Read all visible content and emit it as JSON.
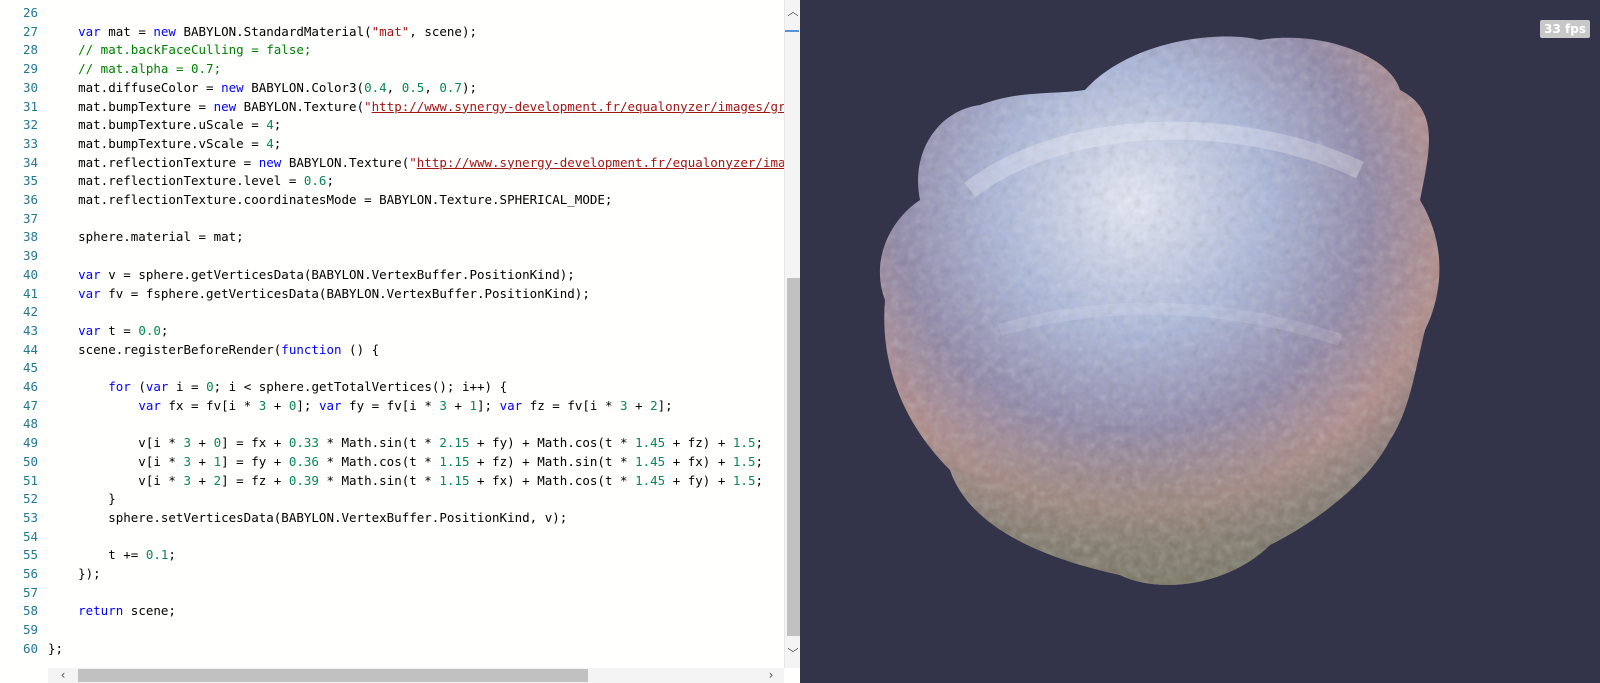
{
  "editor": {
    "lines": [
      {
        "n": "26",
        "tokens": []
      },
      {
        "n": "27",
        "tokens": [
          {
            "t": "    "
          },
          {
            "t": "var",
            "c": "kw"
          },
          {
            "t": " mat = "
          },
          {
            "t": "new",
            "c": "kw"
          },
          {
            "t": " BABYLON.StandardMaterial("
          },
          {
            "t": "\"mat\"",
            "c": "st"
          },
          {
            "t": ", scene);"
          }
        ]
      },
      {
        "n": "28",
        "tokens": [
          {
            "t": "    "
          },
          {
            "t": "// mat.backFaceCulling = false;",
            "c": "cm"
          }
        ]
      },
      {
        "n": "29",
        "tokens": [
          {
            "t": "    "
          },
          {
            "t": "// mat.alpha = 0.7;",
            "c": "cm"
          }
        ]
      },
      {
        "n": "30",
        "tokens": [
          {
            "t": "    mat.diffuseColor = "
          },
          {
            "t": "new",
            "c": "kw"
          },
          {
            "t": " BABYLON.Color3("
          },
          {
            "t": "0.4",
            "c": "nm"
          },
          {
            "t": ", "
          },
          {
            "t": "0.5",
            "c": "nm"
          },
          {
            "t": ", "
          },
          {
            "t": "0.7",
            "c": "nm"
          },
          {
            "t": ");"
          }
        ]
      },
      {
        "n": "31",
        "tokens": [
          {
            "t": "    mat.bumpTexture = "
          },
          {
            "t": "new",
            "c": "kw"
          },
          {
            "t": " BABYLON.Texture("
          },
          {
            "t": "\"",
            "c": "st"
          },
          {
            "t": "http://www.synergy-development.fr/equalonyzer/images/gr",
            "c": "url"
          }
        ]
      },
      {
        "n": "32",
        "tokens": [
          {
            "t": "    mat.bumpTexture.uScale = "
          },
          {
            "t": "4",
            "c": "nm"
          },
          {
            "t": ";"
          }
        ]
      },
      {
        "n": "33",
        "tokens": [
          {
            "t": "    mat.bumpTexture.vScale = "
          },
          {
            "t": "4",
            "c": "nm"
          },
          {
            "t": ";"
          }
        ]
      },
      {
        "n": "34",
        "tokens": [
          {
            "t": "    mat.reflectionTexture = "
          },
          {
            "t": "new",
            "c": "kw"
          },
          {
            "t": " BABYLON.Texture("
          },
          {
            "t": "\"",
            "c": "st"
          },
          {
            "t": "http://www.synergy-development.fr/equalonyzer/ima",
            "c": "url"
          }
        ]
      },
      {
        "n": "35",
        "tokens": [
          {
            "t": "    mat.reflectionTexture.level = "
          },
          {
            "t": "0.6",
            "c": "nm"
          },
          {
            "t": ";"
          }
        ]
      },
      {
        "n": "36",
        "tokens": [
          {
            "t": "    mat.reflectionTexture.coordinatesMode = BABYLON.Texture.SPHERICAL_MODE;"
          }
        ]
      },
      {
        "n": "37",
        "tokens": []
      },
      {
        "n": "38",
        "tokens": [
          {
            "t": "    sphere.material = mat;"
          }
        ]
      },
      {
        "n": "39",
        "tokens": []
      },
      {
        "n": "40",
        "tokens": [
          {
            "t": "    "
          },
          {
            "t": "var",
            "c": "kw"
          },
          {
            "t": " v = sphere.getVerticesData(BABYLON.VertexBuffer.PositionKind);"
          }
        ]
      },
      {
        "n": "41",
        "tokens": [
          {
            "t": "    "
          },
          {
            "t": "var",
            "c": "kw"
          },
          {
            "t": " fv = fsphere.getVerticesData(BABYLON.VertexBuffer.PositionKind);"
          }
        ]
      },
      {
        "n": "42",
        "tokens": []
      },
      {
        "n": "43",
        "tokens": [
          {
            "t": "    "
          },
          {
            "t": "var",
            "c": "kw"
          },
          {
            "t": " t = "
          },
          {
            "t": "0.0",
            "c": "nm"
          },
          {
            "t": ";"
          }
        ]
      },
      {
        "n": "44",
        "tokens": [
          {
            "t": "    scene.registerBeforeRender("
          },
          {
            "t": "function",
            "c": "kw"
          },
          {
            "t": " () {"
          }
        ]
      },
      {
        "n": "45",
        "tokens": []
      },
      {
        "n": "46",
        "tokens": [
          {
            "t": "        "
          },
          {
            "t": "for",
            "c": "kw"
          },
          {
            "t": " ("
          },
          {
            "t": "var",
            "c": "kw"
          },
          {
            "t": " i = "
          },
          {
            "t": "0",
            "c": "nm"
          },
          {
            "t": "; i < sphere.getTotalVertices(); i++) {"
          }
        ]
      },
      {
        "n": "47",
        "tokens": [
          {
            "t": "            "
          },
          {
            "t": "var",
            "c": "kw"
          },
          {
            "t": " fx = fv[i * "
          },
          {
            "t": "3",
            "c": "nm"
          },
          {
            "t": " + "
          },
          {
            "t": "0",
            "c": "nm"
          },
          {
            "t": "]; "
          },
          {
            "t": "var",
            "c": "kw"
          },
          {
            "t": " fy = fv[i * "
          },
          {
            "t": "3",
            "c": "nm"
          },
          {
            "t": " + "
          },
          {
            "t": "1",
            "c": "nm"
          },
          {
            "t": "]; "
          },
          {
            "t": "var",
            "c": "kw"
          },
          {
            "t": " fz = fv[i * "
          },
          {
            "t": "3",
            "c": "nm"
          },
          {
            "t": " + "
          },
          {
            "t": "2",
            "c": "nm"
          },
          {
            "t": "];"
          }
        ]
      },
      {
        "n": "48",
        "tokens": []
      },
      {
        "n": "49",
        "tokens": [
          {
            "t": "            v[i * "
          },
          {
            "t": "3",
            "c": "nm"
          },
          {
            "t": " + "
          },
          {
            "t": "0",
            "c": "nm"
          },
          {
            "t": "] = fx + "
          },
          {
            "t": "0.33",
            "c": "nm"
          },
          {
            "t": " * Math.sin(t * "
          },
          {
            "t": "2.15",
            "c": "nm"
          },
          {
            "t": " + fy) + Math.cos(t * "
          },
          {
            "t": "1.45",
            "c": "nm"
          },
          {
            "t": " + fz) + "
          },
          {
            "t": "1.5",
            "c": "nm"
          },
          {
            "t": ";"
          }
        ]
      },
      {
        "n": "50",
        "tokens": [
          {
            "t": "            v[i * "
          },
          {
            "t": "3",
            "c": "nm"
          },
          {
            "t": " + "
          },
          {
            "t": "1",
            "c": "nm"
          },
          {
            "t": "] = fy + "
          },
          {
            "t": "0.36",
            "c": "nm"
          },
          {
            "t": " * Math.cos(t * "
          },
          {
            "t": "1.15",
            "c": "nm"
          },
          {
            "t": " + fz) + Math.sin(t * "
          },
          {
            "t": "1.45",
            "c": "nm"
          },
          {
            "t": " + fx) + "
          },
          {
            "t": "1.5",
            "c": "nm"
          },
          {
            "t": ";"
          }
        ]
      },
      {
        "n": "51",
        "tokens": [
          {
            "t": "            v[i * "
          },
          {
            "t": "3",
            "c": "nm"
          },
          {
            "t": " + "
          },
          {
            "t": "2",
            "c": "nm"
          },
          {
            "t": "] = fz + "
          },
          {
            "t": "0.39",
            "c": "nm"
          },
          {
            "t": " * Math.sin(t * "
          },
          {
            "t": "1.15",
            "c": "nm"
          },
          {
            "t": " + fx) + Math.cos(t * "
          },
          {
            "t": "1.45",
            "c": "nm"
          },
          {
            "t": " + fy) + "
          },
          {
            "t": "1.5",
            "c": "nm"
          },
          {
            "t": ";"
          }
        ]
      },
      {
        "n": "52",
        "tokens": [
          {
            "t": "        }"
          }
        ]
      },
      {
        "n": "53",
        "tokens": [
          {
            "t": "        sphere.setVerticesData(BABYLON.VertexBuffer.PositionKind, v);"
          }
        ]
      },
      {
        "n": "54",
        "tokens": []
      },
      {
        "n": "55",
        "tokens": [
          {
            "t": "        t += "
          },
          {
            "t": "0.1",
            "c": "nm"
          },
          {
            "t": ";"
          }
        ]
      },
      {
        "n": "56",
        "tokens": [
          {
            "t": "    });"
          }
        ]
      },
      {
        "n": "57",
        "tokens": []
      },
      {
        "n": "58",
        "tokens": [
          {
            "t": "    "
          },
          {
            "t": "return",
            "c": "kw"
          },
          {
            "t": " scene;"
          }
        ]
      },
      {
        "n": "59",
        "tokens": []
      },
      {
        "n": "60",
        "tokens": [
          {
            "t": "};"
          }
        ]
      }
    ],
    "scrollbar_icons": {
      "up": "chevron-up-icon",
      "down": "chevron-down-icon",
      "left": "chevron-left-icon",
      "right": "chevron-right-icon"
    }
  },
  "viewport": {
    "fps_label": "33 fps",
    "background": "#333349",
    "object": "deformed-sphere"
  },
  "colors": {
    "keyword": "#0000ff",
    "comment": "#008000",
    "string": "#a31515",
    "number": "#098658",
    "line_number": "#237893"
  }
}
